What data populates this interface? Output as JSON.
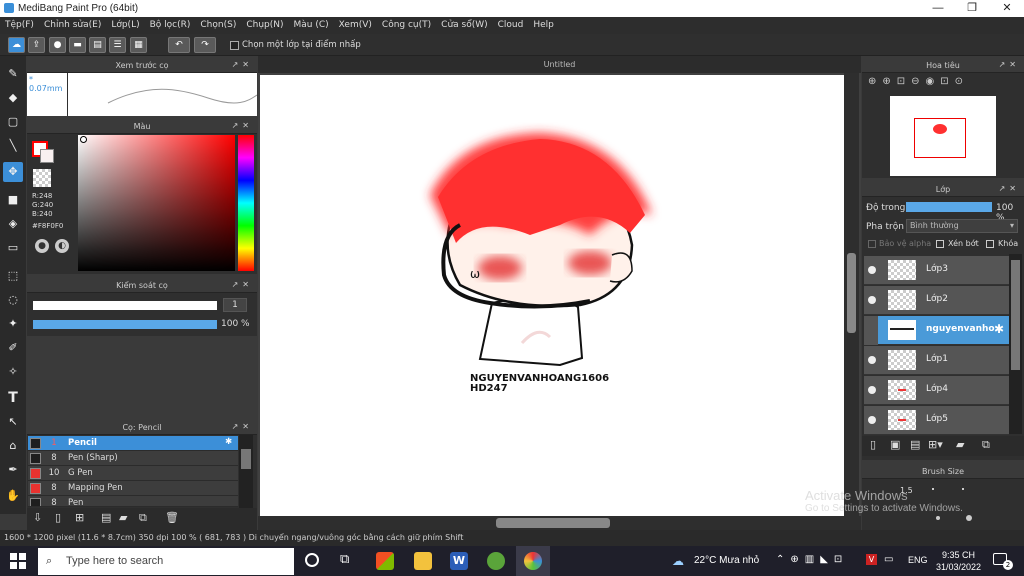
{
  "window": {
    "title": "MediBang Paint Pro (64bit)",
    "minimize": "—",
    "maximize": "❐",
    "close": "✕"
  },
  "menu": [
    "Tệp(F)",
    "Chỉnh sửa(E)",
    "Lớp(L)",
    "Bộ lọc(R)",
    "Chọn(S)",
    "Chụp(N)",
    "Màu (C)",
    "Xem(V)",
    "Công cụ(T)",
    "Cửa sổ(W)",
    "Cloud",
    "Help"
  ],
  "toolbar": {
    "select_layer_label": "Chọn một lớp tại điểm nhấp"
  },
  "preview_panel": {
    "title": "Xem trước cọ",
    "size": "0.07mm"
  },
  "color_panel": {
    "title": "Màu",
    "r": "R:248",
    "g": "G:240",
    "b": "B:240",
    "hex": "#F8F0F0",
    "colors": {
      "primary": "#ff0000",
      "secondary": "#f8f0f0"
    }
  },
  "brush_control": {
    "title": "Kiểm soát cọ",
    "size": "1",
    "opacity": "100 %"
  },
  "brush_list": {
    "title": "Cọ: Pencil",
    "items": [
      {
        "size": "1",
        "name": "Pencil",
        "color": "#1e1e1e"
      },
      {
        "size": "8",
        "name": "Pen (Sharp)",
        "color": "#1e1e1e"
      },
      {
        "size": "10",
        "name": "G Pen",
        "color": "#e8322f"
      },
      {
        "size": "8",
        "name": "Mapping Pen",
        "color": "#e8322f"
      },
      {
        "size": "8",
        "name": "Pen",
        "color": "#1e1e1e"
      }
    ]
  },
  "canvas": {
    "title": "Untitled",
    "signature_line1": "NGUYENVANHOANG1606",
    "signature_line2": "HD247"
  },
  "navigator": {
    "title": "Hoa tiêu"
  },
  "layer_panel": {
    "title": "Lớp",
    "opacity_label": "Độ trong",
    "opacity_value": "100 %",
    "blend_label": "Pha trộn",
    "blend_value": "Bình thường",
    "protect_alpha": "Bảo vệ alpha",
    "clipping": "Xén bớt",
    "lock": "Khóa",
    "layers": [
      "Lớp3",
      "Lớp2",
      "nguyenvanho",
      "Lớp1",
      "Lớp4",
      "Lớp5"
    ]
  },
  "brush_size_panel": {
    "title": "Brush Size",
    "values": [
      "1.5"
    ]
  },
  "watermark": {
    "line1": "Activate Windows",
    "line2": "Go to Settings to activate Windows."
  },
  "status": {
    "text": "1600 * 1200 pixel   (11.6 * 8.7cm)   350 dpi   100 %   ( 681, 783 )   Di chuyển ngang/vuông góc bằng cách giữ phím Shift"
  },
  "taskbar": {
    "search_placeholder": "Type here to search",
    "weather": "22°C  Mưa nhỏ",
    "lang": "ENG",
    "time": "9:35 CH",
    "date": "31/03/2022",
    "notif": "2"
  }
}
